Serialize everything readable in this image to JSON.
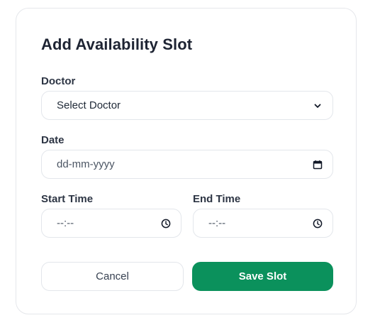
{
  "form": {
    "title": "Add Availability Slot",
    "doctor": {
      "label": "Doctor",
      "selected": "Select Doctor",
      "icon": "chevron-down-icon"
    },
    "date": {
      "label": "Date",
      "value": "dd-mm-yyyy",
      "icon": "calendar-icon"
    },
    "start_time": {
      "label": "Start Time",
      "value": "--:--",
      "icon": "clock-icon"
    },
    "end_time": {
      "label": "End Time",
      "value": "--:--",
      "icon": "clock-icon"
    },
    "cancel_label": "Cancel",
    "save_label": "Save Slot"
  },
  "colors": {
    "primary": "#0b915c",
    "border": "#e3e6eb",
    "heading": "#1e2433"
  }
}
